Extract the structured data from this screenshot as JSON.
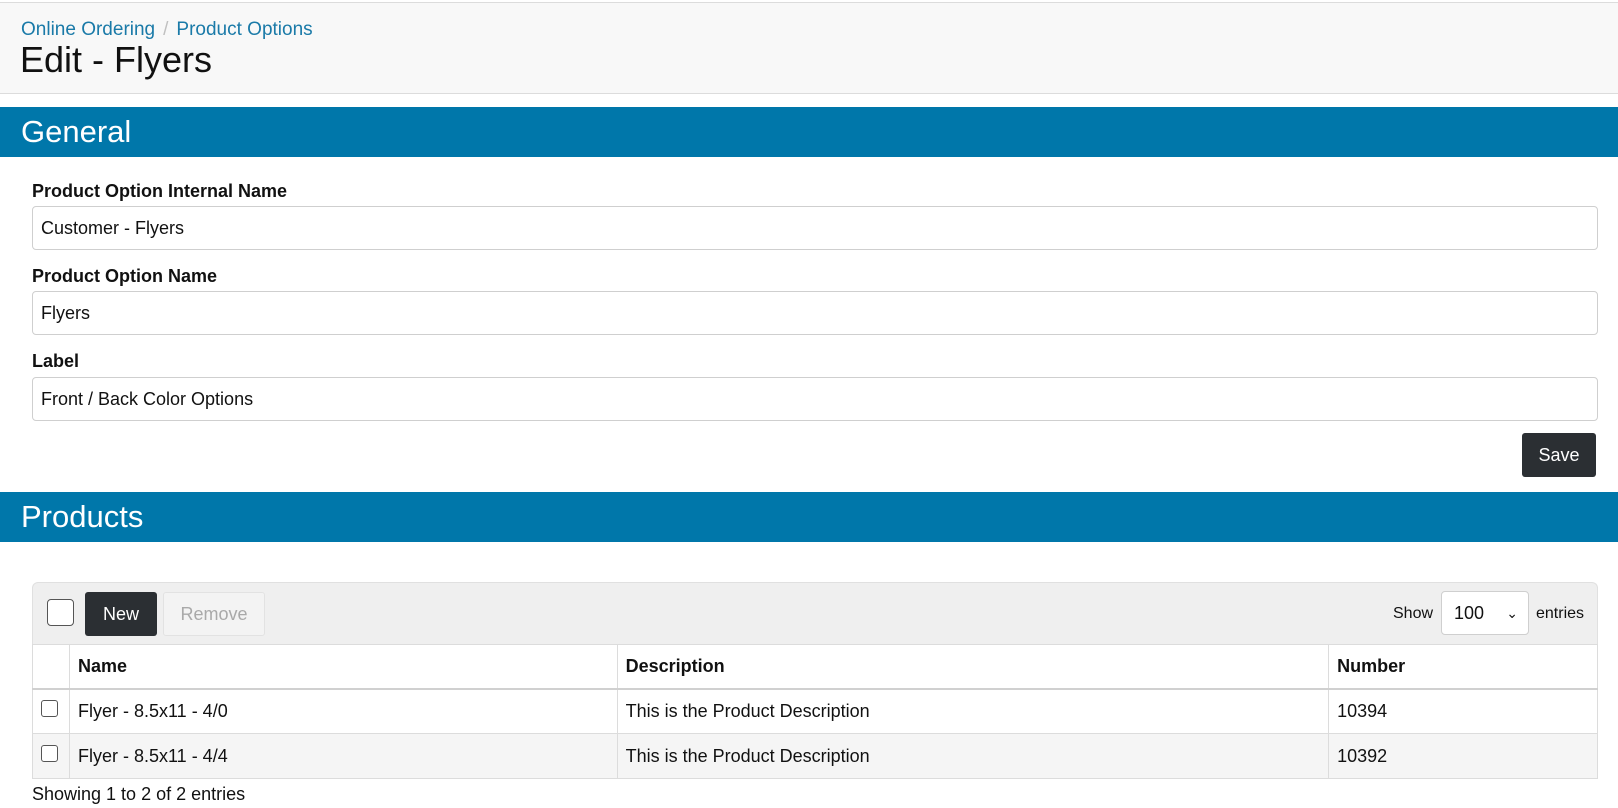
{
  "breadcrumb": {
    "items": [
      "Online Ordering",
      "Product Options"
    ]
  },
  "page_title": "Edit - Flyers",
  "general": {
    "heading": "General",
    "fields": [
      {
        "label": "Product Option Internal Name",
        "value": "Customer - Flyers"
      },
      {
        "label": "Product Option Name",
        "value": "Flyers"
      },
      {
        "label": "Label",
        "value": "Front / Back Color Options"
      }
    ],
    "save_label": "Save"
  },
  "products": {
    "heading": "Products",
    "new_label": "New",
    "remove_label": "Remove",
    "show_label": "Show",
    "entries_value": "100",
    "entries_label": "entries",
    "columns": [
      "Name",
      "Description",
      "Number"
    ],
    "rows": [
      {
        "name": "Flyer - 8.5x11 - 4/0",
        "description": "This is the Product Description",
        "number": "10394"
      },
      {
        "name": "Flyer - 8.5x11 - 4/4",
        "description": "This is the Product Description",
        "number": "10392"
      }
    ],
    "info": "Showing 1 to 2 of 2 entries"
  },
  "colors": {
    "accent": "#0077aa",
    "dark_button": "#2b2f33",
    "link": "#1a7aa8"
  }
}
